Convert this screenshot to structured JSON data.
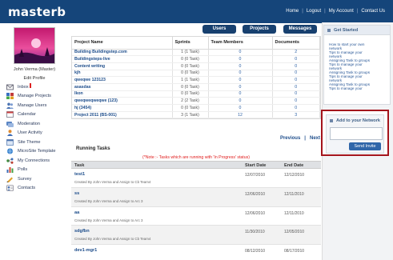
{
  "header": {
    "brand": "masterb",
    "nav": [
      "Home",
      "Logout",
      "My Account",
      "Contact Us"
    ]
  },
  "profile": {
    "name": "John Verma (Master)",
    "edit_label": "Edit Profile"
  },
  "sidebar": {
    "items": [
      {
        "label": "Inbox",
        "icon": "inbox-icon"
      },
      {
        "label": "Manage Projects",
        "icon": "projects-icon"
      },
      {
        "label": "Manage Users",
        "icon": "users-icon"
      },
      {
        "label": "Calendar",
        "icon": "calendar-icon"
      },
      {
        "label": "Moderation",
        "icon": "moderation-icon"
      },
      {
        "label": "User Activity",
        "icon": "activity-icon"
      },
      {
        "label": "Site Theme",
        "icon": "theme-icon"
      },
      {
        "label": "MicroSite Template",
        "icon": "template-icon"
      },
      {
        "label": "My Connections",
        "icon": "connections-icon"
      },
      {
        "label": "Polls",
        "icon": "polls-icon"
      },
      {
        "label": "Survey",
        "icon": "survey-icon"
      },
      {
        "label": "Contacts",
        "icon": "contacts-icon"
      }
    ]
  },
  "tabs": {
    "users": "Users",
    "projects": "Projects",
    "messages": "Messages"
  },
  "projects_table": {
    "columns": [
      "Project Name",
      "Sprints",
      "Team Members",
      "Documents"
    ],
    "rows": [
      [
        "Building Buildingstep.com",
        "1 (1 Task)",
        "0",
        "2"
      ],
      [
        "Buildingsteps-live",
        "0 (0 Task)",
        "0",
        "0"
      ],
      [
        "Content writing",
        "0 (0 Task)",
        "0",
        "0"
      ],
      [
        "kjh",
        "0 (0 Task)",
        "0",
        "0"
      ],
      [
        "qweqwe 123123",
        "1 (1 Task)",
        "0",
        "0"
      ],
      [
        "asasdas",
        "0 (0 Task)",
        "0",
        "0"
      ],
      [
        "lkon",
        "0 (0 Task)",
        "0",
        "0"
      ],
      [
        "qweqweqweqwe (123)",
        "2 (2 Task)",
        "0",
        "0"
      ],
      [
        "hj (3454)",
        "0 (0 Task)",
        "0",
        "0"
      ],
      [
        "Project 2011 (BS-001)",
        "3 (1 Task)",
        "12",
        "3"
      ]
    ]
  },
  "pager": {
    "previous": "Previous",
    "separator": "|",
    "next": "Next"
  },
  "running_tasks": {
    "title": "Running Tasks",
    "note": "(*Note :- Tasks which are running with 'In Progress' status)",
    "columns": [
      "Task",
      "Start Date",
      "End Date"
    ],
    "rows": [
      {
        "name": "test1",
        "by": "Created By John Verma and Assign to Cb Team4",
        "start": "12/07/2010",
        "end": "12/12/2010"
      },
      {
        "name": "ss",
        "by": "Created By John Verma and Assign to Arc 3",
        "start": "12/06/2010",
        "end": "12/11/2010"
      },
      {
        "name": "aa",
        "by": "Created By John Verma and Assign to Arc 3",
        "start": "12/06/2010",
        "end": "12/11/2010"
      },
      {
        "name": "sdgfbn",
        "by": "Created By John Verma and Assign to Cb Team4",
        "start": "11/30/2010",
        "end": "12/05/2010"
      },
      {
        "name": "dev1-mgr1",
        "by": "",
        "start": "08/12/2010",
        "end": "08/17/2010"
      }
    ]
  },
  "get_started": {
    "title": "Get Started",
    "links": [
      "How to start your own",
      "network",
      "Tips to manage your",
      "network",
      "Assigning Task to groups",
      "Tips to manage your",
      "network",
      "Assigning Task to groups",
      "Tips to manage your",
      "network",
      "Assigning Task to groups",
      "Tips to manage your"
    ]
  },
  "add_network": {
    "title": "Add to your Network",
    "button": "Send Invite"
  },
  "colors": {
    "topbar": "#15457a",
    "tab": "#17406f",
    "highlight_border": "#a4141c",
    "link": "#1d4d8b",
    "note": "#e01b1b"
  }
}
